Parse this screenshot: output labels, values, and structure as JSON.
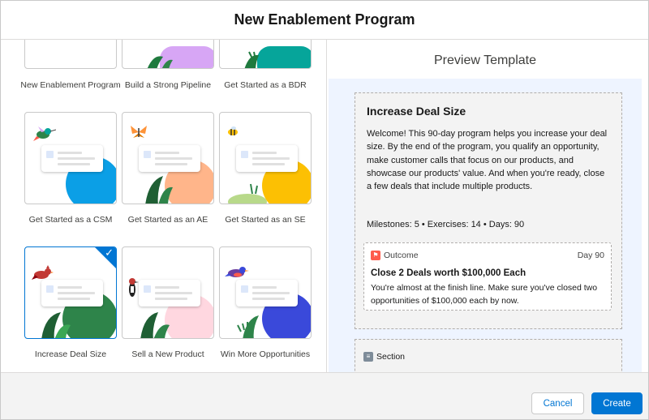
{
  "modal": {
    "title": "New Enablement Program"
  },
  "gallery": {
    "templates": [
      {
        "label": "New Enablement Program",
        "art": "blank"
      },
      {
        "label": "Build a Strong Pipeline",
        "art": "purple"
      },
      {
        "label": "Get Started as a BDR",
        "art": "teal"
      },
      {
        "label": "Get Started as a CSM",
        "art": "blue",
        "icon": "hummingbird-icon"
      },
      {
        "label": "Get Started as an AE",
        "art": "peach",
        "icon": "butterfly-icon"
      },
      {
        "label": "Get Started as an SE",
        "art": "yellow",
        "icon": "bee-icon"
      },
      {
        "label": "Increase Deal Size",
        "art": "green",
        "icon": "cardinal-icon",
        "selected": true
      },
      {
        "label": "Sell a New Product",
        "art": "pink",
        "icon": "woodpecker-icon"
      },
      {
        "label": "Win More Opportunities",
        "art": "indigo",
        "icon": "bird-icon"
      }
    ]
  },
  "preview": {
    "title": "Preview Template",
    "program": {
      "heading": "Increase Deal Size",
      "description": "Welcome! This 90-day program helps you increase your deal size. By the end of the program, you qualify an opportunity, make customer calls that focus on our products, and showcase our products' value. And when you're ready, close a few deals that include multiple products.",
      "stats": "Milestones: 5 • Exercises: 14 • Days: 90"
    },
    "outcome": {
      "label": "Outcome",
      "day": "Day 90",
      "title": "Close 2 Deals worth $100,000 Each",
      "text": "You're almost at the finish line. Make sure you've closed two opportunities of $100,000 each by now."
    },
    "section": {
      "label": "Section"
    }
  },
  "footer": {
    "cancel_label": "Cancel",
    "create_label": "Create"
  },
  "colors": {
    "brand": "#0176d3",
    "purple": "#d7a6f5",
    "teal": "#06a59a",
    "blue": "#0b9fe6",
    "peach": "#ffb58a",
    "yellow": "#fcc003",
    "green": "#2e844a",
    "pink": "#ffd7e0",
    "indigo": "#3a49da",
    "outcome": "#fe5c4c"
  }
}
